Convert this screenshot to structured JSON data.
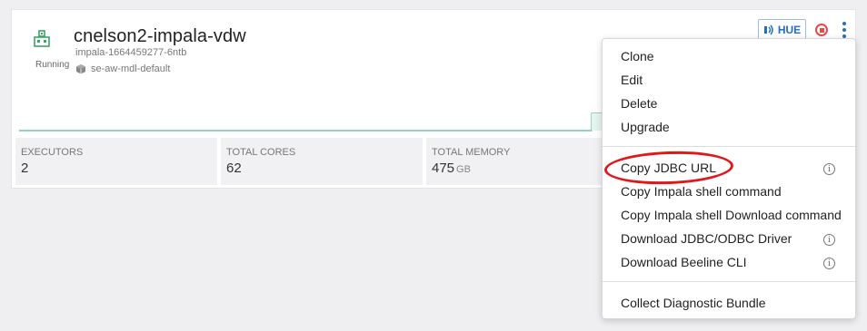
{
  "cluster": {
    "name": "cnelson2-impala-vdw",
    "id": "impala-1664459277-6ntb",
    "environment": "se-aw-mdl-default",
    "status": "Running",
    "status_color": "#3da369"
  },
  "actions": {
    "hue_label": "HUE",
    "accent": "#1f6fc5",
    "stop_color": "#e64a4a"
  },
  "stats": [
    {
      "label": "EXECUTORS",
      "value": "2",
      "unit": ""
    },
    {
      "label": "TOTAL CORES",
      "value": "62",
      "unit": ""
    },
    {
      "label": "TOTAL MEMORY",
      "value": "475",
      "unit": "GB"
    }
  ],
  "menu": {
    "group1": [
      "Clone",
      "Edit",
      "Delete",
      "Upgrade"
    ],
    "group2": [
      {
        "label": "Copy JDBC URL",
        "info": true
      },
      {
        "label": "Copy Impala shell command",
        "info": false
      },
      {
        "label": "Copy Impala shell Download command",
        "info": false
      },
      {
        "label": "Download JDBC/ODBC Driver",
        "info": true
      },
      {
        "label": "Download Beeline CLI",
        "info": true
      }
    ],
    "group3": [
      "Collect Diagnostic Bundle"
    ],
    "info_glyph": "i",
    "highlight_color": "#e3161b"
  }
}
